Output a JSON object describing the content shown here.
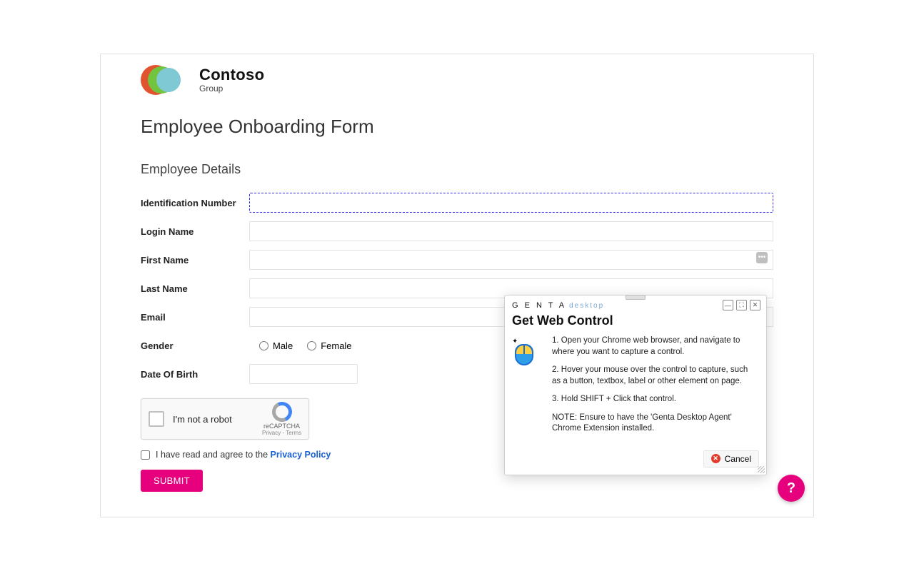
{
  "brand": {
    "name": "Contoso",
    "sub": "Group"
  },
  "page": {
    "title": "Employee Onboarding Form"
  },
  "section": {
    "employee_details": "Employee Details"
  },
  "fields": {
    "id_number": {
      "label": "Identification Number",
      "value": ""
    },
    "login_name": {
      "label": "Login Name",
      "value": ""
    },
    "first_name": {
      "label": "First Name",
      "value": ""
    },
    "last_name": {
      "label": "Last Name",
      "value": ""
    },
    "email": {
      "label": "Email",
      "value": ""
    },
    "gender": {
      "label": "Gender",
      "options": {
        "male": "Male",
        "female": "Female"
      }
    },
    "dob": {
      "label": "Date Of Birth",
      "value": ""
    }
  },
  "recaptcha": {
    "text": "I'm not a robot",
    "brand": "reCAPTCHA",
    "links": "Privacy - Terms"
  },
  "agree": {
    "prefix": "I have read and agree to the ",
    "link": "Privacy Policy"
  },
  "submit": {
    "label": "SUBMIT"
  },
  "help_fab": "?",
  "dialog": {
    "brand": "G E N T A",
    "brand_sub": "desktop",
    "title": "Get Web Control",
    "step1": "1. Open your Chrome web browser, and navigate to where you want to capture a control.",
    "step2": "2. Hover your mouse over the control to capture, such as a button, textbox, label or other element on page.",
    "step3": "3. Hold SHIFT + Click that control.",
    "note": "NOTE: Ensure to have the 'Genta Desktop Agent' Chrome Extension installed.",
    "cancel": "Cancel",
    "fn_badge": "•••"
  },
  "colors": {
    "accent": "#e6007e",
    "link": "#1a5fd0"
  }
}
